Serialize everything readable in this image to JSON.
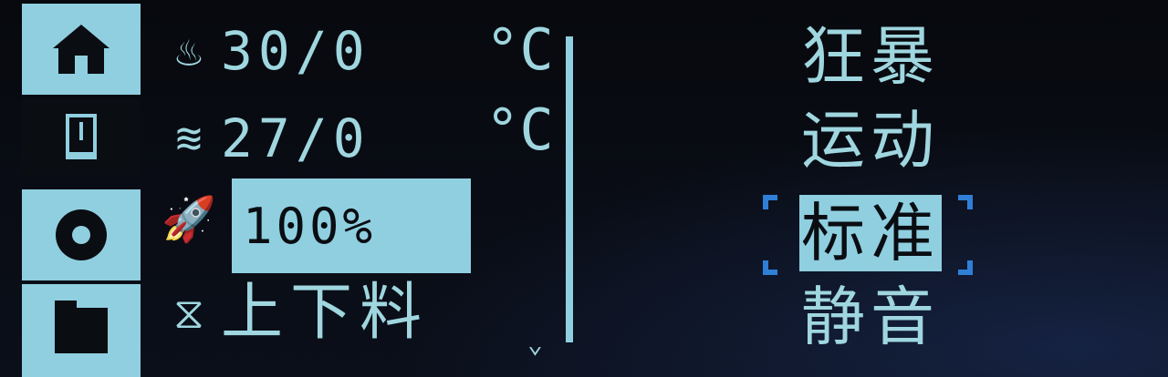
{
  "sidebar": {
    "items": [
      {
        "id": "home",
        "icon": "home-icon",
        "selected": true
      },
      {
        "id": "print",
        "icon": "print-icon",
        "selected": false
      },
      {
        "id": "settings",
        "icon": "gear-icon",
        "selected": true
      },
      {
        "id": "files",
        "icon": "folder-icon",
        "selected": true
      }
    ]
  },
  "status": {
    "hotend": {
      "icon": "hotend-icon",
      "value": "30/0",
      "unit": "°C"
    },
    "bed": {
      "icon": "bed-icon",
      "value": "27/0",
      "unit": "°C"
    },
    "speed": {
      "icon": "rocket-icon",
      "value": "100%"
    },
    "filament": {
      "icon": "filament-icon",
      "label": "上下料"
    }
  },
  "scroll": {
    "indicator": "⌄"
  },
  "modes": {
    "items": [
      "狂暴",
      "运动",
      "标准",
      "静音"
    ],
    "selected": "标准"
  },
  "colors": {
    "lcd_fg": "#9fd6df",
    "lcd_highlight": "#8fcfe0",
    "bracket": "#2f7fd6",
    "background": "#05070b"
  }
}
